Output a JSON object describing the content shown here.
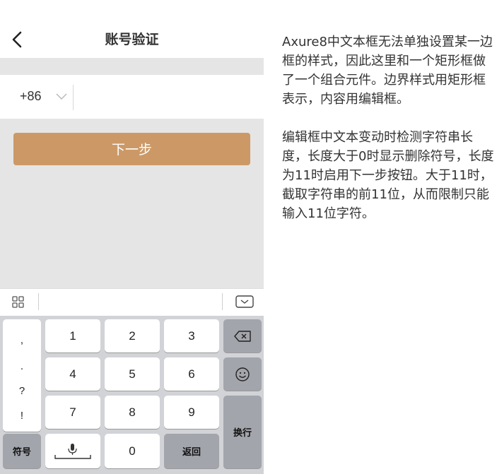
{
  "header": {
    "title": "账号验证"
  },
  "phone_row": {
    "country_code": "+86",
    "input_value": "",
    "input_placeholder": ""
  },
  "next_button": {
    "label": "下一步",
    "color": "#cc9966"
  },
  "keyboard": {
    "punctuation": [
      ",",
      ".",
      "?",
      "!"
    ],
    "digits": [
      "1",
      "2",
      "3",
      "4",
      "5",
      "6",
      "7",
      "8",
      "9",
      "0"
    ],
    "symbols_label": "符号",
    "return_label": "返回",
    "newline_label": "换行",
    "icons": [
      "grid-icon",
      "keyboard-hide-icon",
      "backspace-icon",
      "emoji-icon",
      "microphone-icon"
    ]
  },
  "description": {
    "paragraph1": "Axure8中文本框无法单独设置某一边框的样式，因此这里和一个矩形框做了一个组合元件。边界样式用矩形框表示，内容用编辑框。",
    "paragraph2": "编辑框中文本变动时检测字符串长度，长度大于0时显示删除符号，长度为11时启用下一步按钮。大于11时，截取字符串的前11位，从而限制只能输入11位字符。"
  }
}
